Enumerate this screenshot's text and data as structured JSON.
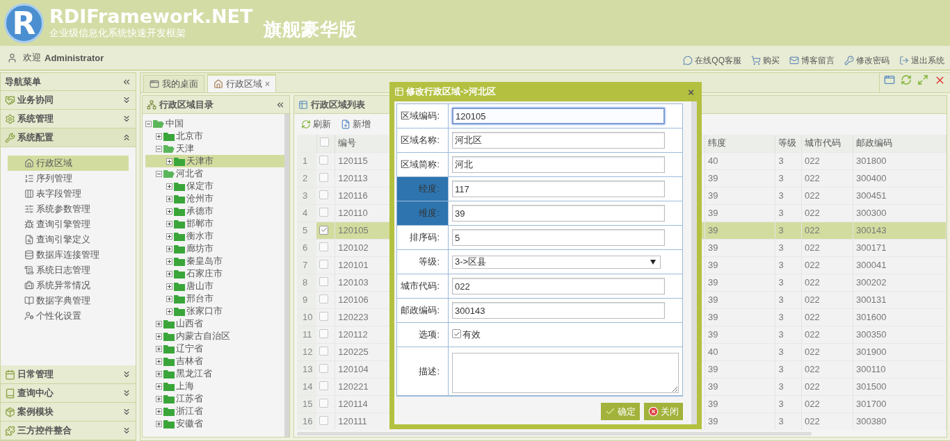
{
  "header": {
    "logo_letter": "R",
    "title": "RDIFramework.NET",
    "subtitle": "企业级信息化系统快速开发框架",
    "edition": "旗舰豪华版"
  },
  "userbar": {
    "welcome": "欢迎",
    "user": "Administrator",
    "links": [
      "在线QQ客服",
      "购买",
      "博客留言",
      "修改密码",
      "退出系统"
    ]
  },
  "nav": {
    "title": "导航菜单",
    "sections": [
      {
        "label": "业务协同",
        "expanded": false
      },
      {
        "label": "系统管理",
        "expanded": false
      },
      {
        "label": "系统配置",
        "expanded": true,
        "items": [
          {
            "label": "行政区域",
            "selected": true
          },
          {
            "label": "序列管理",
            "selected": false
          },
          {
            "label": "表字段管理",
            "selected": false
          },
          {
            "label": "系统参数管理",
            "selected": false
          },
          {
            "label": "查询引擎管理",
            "selected": false
          },
          {
            "label": "查询引擎定义",
            "selected": false
          },
          {
            "label": "数据库连接管理",
            "selected": false
          },
          {
            "label": "系统日志管理",
            "selected": false
          },
          {
            "label": "系统异常情况",
            "selected": false
          },
          {
            "label": "数据字典管理",
            "selected": false
          },
          {
            "label": "个性化设置",
            "selected": false
          }
        ]
      },
      {
        "label": "日常管理",
        "expanded": false
      },
      {
        "label": "查询中心",
        "expanded": false
      },
      {
        "label": "案例模块",
        "expanded": false
      },
      {
        "label": "三方控件整合",
        "expanded": false
      }
    ]
  },
  "tabs": [
    {
      "label": "我的桌面",
      "selected": false,
      "closable": false
    },
    {
      "label": "行政区域",
      "selected": true,
      "closable": true
    }
  ],
  "close_glyph": "×",
  "tree": {
    "title": "行政区域目录",
    "nodes": [
      {
        "label": "中国",
        "expanded": true,
        "selected": false,
        "children": [
          {
            "label": "北京市",
            "expanded": false,
            "selected": false
          },
          {
            "label": "天津",
            "expanded": true,
            "selected": false,
            "children": [
              {
                "label": "天津市",
                "expanded": false,
                "selected": true
              }
            ]
          },
          {
            "label": "河北省",
            "expanded": true,
            "selected": false,
            "children": [
              {
                "label": "保定市",
                "expanded": false,
                "selected": false
              },
              {
                "label": "沧州市",
                "expanded": false,
                "selected": false
              },
              {
                "label": "承德市",
                "expanded": false,
                "selected": false
              },
              {
                "label": "邯郸市",
                "expanded": false,
                "selected": false
              },
              {
                "label": "衡水市",
                "expanded": false,
                "selected": false
              },
              {
                "label": "廊坊市",
                "expanded": false,
                "selected": false
              },
              {
                "label": "秦皇岛市",
                "expanded": false,
                "selected": false
              },
              {
                "label": "石家庄市",
                "expanded": false,
                "selected": false
              },
              {
                "label": "唐山市",
                "expanded": false,
                "selected": false
              },
              {
                "label": "邢台市",
                "expanded": false,
                "selected": false
              },
              {
                "label": "张家口市",
                "expanded": false,
                "selected": false
              }
            ]
          },
          {
            "label": "山西省",
            "expanded": false,
            "selected": false
          },
          {
            "label": "内蒙古自治区",
            "expanded": false,
            "selected": false
          },
          {
            "label": "辽宁省",
            "expanded": false,
            "selected": false
          },
          {
            "label": "吉林省",
            "expanded": false,
            "selected": false
          },
          {
            "label": "黑龙江省",
            "expanded": false,
            "selected": false
          },
          {
            "label": "上海",
            "expanded": false,
            "selected": false
          },
          {
            "label": "江苏省",
            "expanded": false,
            "selected": false
          },
          {
            "label": "浙江省",
            "expanded": false,
            "selected": false
          },
          {
            "label": "安徽省",
            "expanded": false,
            "selected": false
          }
        ]
      }
    ]
  },
  "list": {
    "title": "行政区域列表",
    "toolbar": [
      "刷新",
      "新增"
    ],
    "header_checked": false,
    "columns": [
      "编号",
      "纬度",
      "等级",
      "城市代码",
      "邮政编码"
    ],
    "rows": [
      {
        "number": "1",
        "checked": false,
        "selected": false,
        "cells": [
          "120115",
          "40",
          "3",
          "022",
          "301800"
        ]
      },
      {
        "number": "2",
        "checked": false,
        "selected": false,
        "cells": [
          "120113",
          "39",
          "3",
          "022",
          "300400"
        ]
      },
      {
        "number": "3",
        "checked": false,
        "selected": false,
        "cells": [
          "120116",
          "39",
          "3",
          "022",
          "300451"
        ]
      },
      {
        "number": "4",
        "checked": false,
        "selected": false,
        "cells": [
          "120110",
          "39",
          "3",
          "022",
          "300300"
        ]
      },
      {
        "number": "5",
        "checked": true,
        "selected": true,
        "cells": [
          "120105",
          "39",
          "3",
          "022",
          "300143"
        ]
      },
      {
        "number": "6",
        "checked": false,
        "selected": false,
        "cells": [
          "120102",
          "39",
          "3",
          "022",
          "300171"
        ]
      },
      {
        "number": "7",
        "checked": false,
        "selected": false,
        "cells": [
          "120101",
          "39",
          "3",
          "022",
          "300041"
        ]
      },
      {
        "number": "8",
        "checked": false,
        "selected": false,
        "cells": [
          "120103",
          "39",
          "3",
          "022",
          "300202"
        ]
      },
      {
        "number": "9",
        "checked": false,
        "selected": false,
        "cells": [
          "120106",
          "39",
          "3",
          "022",
          "300131"
        ]
      },
      {
        "number": "10",
        "checked": false,
        "selected": false,
        "cells": [
          "120223",
          "39",
          "3",
          "022",
          "301600"
        ]
      },
      {
        "number": "11",
        "checked": false,
        "selected": false,
        "cells": [
          "120112",
          "39",
          "3",
          "022",
          "300350"
        ]
      },
      {
        "number": "12",
        "checked": false,
        "selected": false,
        "cells": [
          "120225",
          "40",
          "3",
          "022",
          "301900"
        ]
      },
      {
        "number": "13",
        "checked": false,
        "selected": false,
        "cells": [
          "120104",
          "39",
          "3",
          "022",
          "300110"
        ]
      },
      {
        "number": "14",
        "checked": false,
        "selected": false,
        "cells": [
          "120221",
          "39",
          "3",
          "022",
          "301500"
        ]
      },
      {
        "number": "15",
        "checked": false,
        "selected": false,
        "cells": [
          "120114",
          "39",
          "3",
          "022",
          "301700"
        ]
      },
      {
        "number": "16",
        "checked": false,
        "selected": false,
        "cells": [
          "120111",
          "39",
          "3",
          "022",
          "300380"
        ]
      }
    ]
  },
  "dialog": {
    "title": "修改行政区域->河北区",
    "fields": [
      {
        "kind": "text",
        "label": "区域编码:",
        "value": "120105",
        "highlighted": false,
        "focused": true
      },
      {
        "kind": "text",
        "label": "区域名称:",
        "value": "河北区",
        "highlighted": false,
        "focused": false
      },
      {
        "kind": "text",
        "label": "区域简称:",
        "value": "河北",
        "highlighted": false,
        "focused": false
      },
      {
        "kind": "text",
        "label": "经度:",
        "value": "117",
        "highlighted": true,
        "focused": false
      },
      {
        "kind": "text",
        "label": "维度:",
        "value": "39",
        "highlighted": true,
        "focused": false
      },
      {
        "kind": "text",
        "label": "排序码:",
        "value": "5",
        "highlighted": false,
        "focused": false
      },
      {
        "kind": "select",
        "label": "等级:",
        "value": "3->区县",
        "highlighted": false
      },
      {
        "kind": "text",
        "label": "城市代码:",
        "value": "022",
        "highlighted": false,
        "focused": false
      },
      {
        "kind": "text",
        "label": "邮政编码:",
        "value": "300143",
        "highlighted": false,
        "focused": false
      },
      {
        "kind": "checkbox",
        "label": "选项:",
        "value": "有效",
        "checked": true,
        "highlighted": false
      },
      {
        "kind": "textarea",
        "label": "描述:",
        "highlighted": false
      }
    ],
    "buttons": [
      {
        "kind": "ok",
        "label": "确定"
      },
      {
        "kind": "close",
        "label": "关闭"
      }
    ]
  }
}
